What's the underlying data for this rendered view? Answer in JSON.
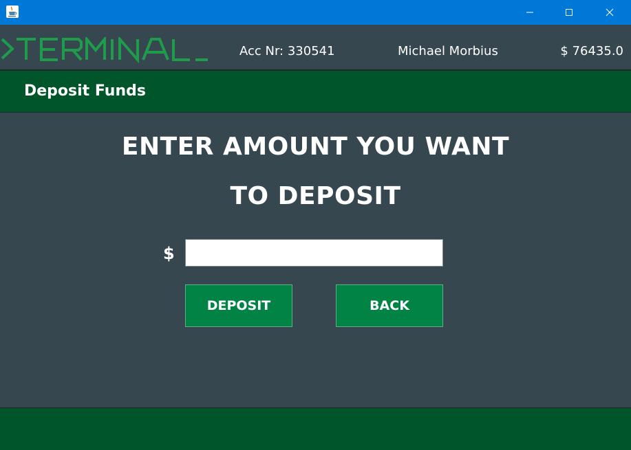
{
  "window": {
    "app_icon": "java-cup-icon",
    "controls": [
      "minimize-icon",
      "maximize-icon",
      "close-icon"
    ]
  },
  "header": {
    "logo_text": ">TERMINAL_",
    "account": "Acc Nr: 330541",
    "name": "Michael Morbius",
    "balance": "$ 76435.0"
  },
  "section": {
    "title": "Deposit Funds"
  },
  "main": {
    "prompt_line1": "ENTER AMOUNT YOU WANT",
    "prompt_line2": "TO DEPOSIT",
    "currency_symbol": "$",
    "amount_value": "",
    "deposit_label": "DEPOSIT",
    "back_label": "BACK"
  },
  "colors": {
    "titlebar": "#0078d7",
    "background": "#36474f",
    "bar_green": "#00562a",
    "button_green": "#008345",
    "logo_green": "#1f9b4c"
  }
}
